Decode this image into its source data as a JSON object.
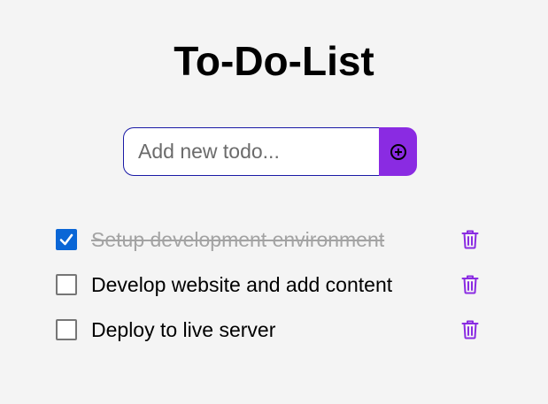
{
  "app": {
    "title": "To-Do-List"
  },
  "add_form": {
    "placeholder": "Add new todo...",
    "value": "",
    "button_icon": "plus-circle-icon",
    "accent_color": "#8a2be2"
  },
  "todos": [
    {
      "text": "Setup development environment",
      "completed": true,
      "delete_icon": "trash-icon"
    },
    {
      "text": "Develop website and add content",
      "completed": false,
      "delete_icon": "trash-icon"
    },
    {
      "text": "Deploy to live server",
      "completed": false,
      "delete_icon": "trash-icon"
    }
  ],
  "colors": {
    "background": "#f4f4f4",
    "checkbox_checked": "#0a66d6",
    "icon": "#8a2be2",
    "completed_text": "#a3a3a3"
  }
}
